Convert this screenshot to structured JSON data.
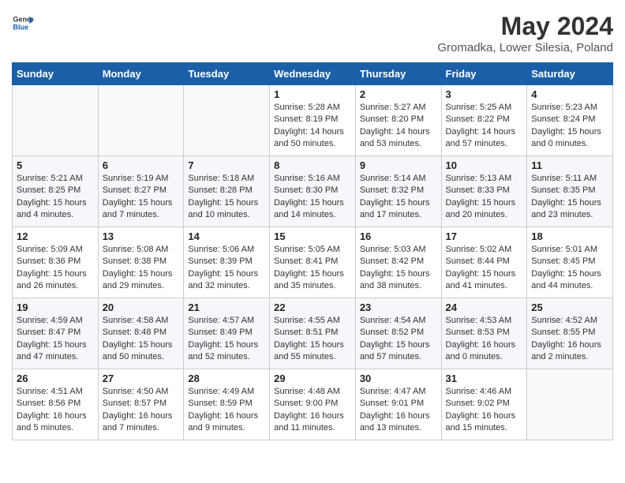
{
  "header": {
    "logo_line1": "General",
    "logo_line2": "Blue",
    "month": "May 2024",
    "location": "Gromadka, Lower Silesia, Poland"
  },
  "weekdays": [
    "Sunday",
    "Monday",
    "Tuesday",
    "Wednesday",
    "Thursday",
    "Friday",
    "Saturday"
  ],
  "weeks": [
    [
      {
        "day": "",
        "sunrise": "",
        "sunset": "",
        "daylight": ""
      },
      {
        "day": "",
        "sunrise": "",
        "sunset": "",
        "daylight": ""
      },
      {
        "day": "",
        "sunrise": "",
        "sunset": "",
        "daylight": ""
      },
      {
        "day": "1",
        "sunrise": "Sunrise: 5:28 AM",
        "sunset": "Sunset: 8:19 PM",
        "daylight": "Daylight: 14 hours and 50 minutes."
      },
      {
        "day": "2",
        "sunrise": "Sunrise: 5:27 AM",
        "sunset": "Sunset: 8:20 PM",
        "daylight": "Daylight: 14 hours and 53 minutes."
      },
      {
        "day": "3",
        "sunrise": "Sunrise: 5:25 AM",
        "sunset": "Sunset: 8:22 PM",
        "daylight": "Daylight: 14 hours and 57 minutes."
      },
      {
        "day": "4",
        "sunrise": "Sunrise: 5:23 AM",
        "sunset": "Sunset: 8:24 PM",
        "daylight": "Daylight: 15 hours and 0 minutes."
      }
    ],
    [
      {
        "day": "5",
        "sunrise": "Sunrise: 5:21 AM",
        "sunset": "Sunset: 8:25 PM",
        "daylight": "Daylight: 15 hours and 4 minutes."
      },
      {
        "day": "6",
        "sunrise": "Sunrise: 5:19 AM",
        "sunset": "Sunset: 8:27 PM",
        "daylight": "Daylight: 15 hours and 7 minutes."
      },
      {
        "day": "7",
        "sunrise": "Sunrise: 5:18 AM",
        "sunset": "Sunset: 8:28 PM",
        "daylight": "Daylight: 15 hours and 10 minutes."
      },
      {
        "day": "8",
        "sunrise": "Sunrise: 5:16 AM",
        "sunset": "Sunset: 8:30 PM",
        "daylight": "Daylight: 15 hours and 14 minutes."
      },
      {
        "day": "9",
        "sunrise": "Sunrise: 5:14 AM",
        "sunset": "Sunset: 8:32 PM",
        "daylight": "Daylight: 15 hours and 17 minutes."
      },
      {
        "day": "10",
        "sunrise": "Sunrise: 5:13 AM",
        "sunset": "Sunset: 8:33 PM",
        "daylight": "Daylight: 15 hours and 20 minutes."
      },
      {
        "day": "11",
        "sunrise": "Sunrise: 5:11 AM",
        "sunset": "Sunset: 8:35 PM",
        "daylight": "Daylight: 15 hours and 23 minutes."
      }
    ],
    [
      {
        "day": "12",
        "sunrise": "Sunrise: 5:09 AM",
        "sunset": "Sunset: 8:36 PM",
        "daylight": "Daylight: 15 hours and 26 minutes."
      },
      {
        "day": "13",
        "sunrise": "Sunrise: 5:08 AM",
        "sunset": "Sunset: 8:38 PM",
        "daylight": "Daylight: 15 hours and 29 minutes."
      },
      {
        "day": "14",
        "sunrise": "Sunrise: 5:06 AM",
        "sunset": "Sunset: 8:39 PM",
        "daylight": "Daylight: 15 hours and 32 minutes."
      },
      {
        "day": "15",
        "sunrise": "Sunrise: 5:05 AM",
        "sunset": "Sunset: 8:41 PM",
        "daylight": "Daylight: 15 hours and 35 minutes."
      },
      {
        "day": "16",
        "sunrise": "Sunrise: 5:03 AM",
        "sunset": "Sunset: 8:42 PM",
        "daylight": "Daylight: 15 hours and 38 minutes."
      },
      {
        "day": "17",
        "sunrise": "Sunrise: 5:02 AM",
        "sunset": "Sunset: 8:44 PM",
        "daylight": "Daylight: 15 hours and 41 minutes."
      },
      {
        "day": "18",
        "sunrise": "Sunrise: 5:01 AM",
        "sunset": "Sunset: 8:45 PM",
        "daylight": "Daylight: 15 hours and 44 minutes."
      }
    ],
    [
      {
        "day": "19",
        "sunrise": "Sunrise: 4:59 AM",
        "sunset": "Sunset: 8:47 PM",
        "daylight": "Daylight: 15 hours and 47 minutes."
      },
      {
        "day": "20",
        "sunrise": "Sunrise: 4:58 AM",
        "sunset": "Sunset: 8:48 PM",
        "daylight": "Daylight: 15 hours and 50 minutes."
      },
      {
        "day": "21",
        "sunrise": "Sunrise: 4:57 AM",
        "sunset": "Sunset: 8:49 PM",
        "daylight": "Daylight: 15 hours and 52 minutes."
      },
      {
        "day": "22",
        "sunrise": "Sunrise: 4:55 AM",
        "sunset": "Sunset: 8:51 PM",
        "daylight": "Daylight: 15 hours and 55 minutes."
      },
      {
        "day": "23",
        "sunrise": "Sunrise: 4:54 AM",
        "sunset": "Sunset: 8:52 PM",
        "daylight": "Daylight: 15 hours and 57 minutes."
      },
      {
        "day": "24",
        "sunrise": "Sunrise: 4:53 AM",
        "sunset": "Sunset: 8:53 PM",
        "daylight": "Daylight: 16 hours and 0 minutes."
      },
      {
        "day": "25",
        "sunrise": "Sunrise: 4:52 AM",
        "sunset": "Sunset: 8:55 PM",
        "daylight": "Daylight: 16 hours and 2 minutes."
      }
    ],
    [
      {
        "day": "26",
        "sunrise": "Sunrise: 4:51 AM",
        "sunset": "Sunset: 8:56 PM",
        "daylight": "Daylight: 16 hours and 5 minutes."
      },
      {
        "day": "27",
        "sunrise": "Sunrise: 4:50 AM",
        "sunset": "Sunset: 8:57 PM",
        "daylight": "Daylight: 16 hours and 7 minutes."
      },
      {
        "day": "28",
        "sunrise": "Sunrise: 4:49 AM",
        "sunset": "Sunset: 8:59 PM",
        "daylight": "Daylight: 16 hours and 9 minutes."
      },
      {
        "day": "29",
        "sunrise": "Sunrise: 4:48 AM",
        "sunset": "Sunset: 9:00 PM",
        "daylight": "Daylight: 16 hours and 11 minutes."
      },
      {
        "day": "30",
        "sunrise": "Sunrise: 4:47 AM",
        "sunset": "Sunset: 9:01 PM",
        "daylight": "Daylight: 16 hours and 13 minutes."
      },
      {
        "day": "31",
        "sunrise": "Sunrise: 4:46 AM",
        "sunset": "Sunset: 9:02 PM",
        "daylight": "Daylight: 16 hours and 15 minutes."
      },
      {
        "day": "",
        "sunrise": "",
        "sunset": "",
        "daylight": ""
      }
    ]
  ]
}
